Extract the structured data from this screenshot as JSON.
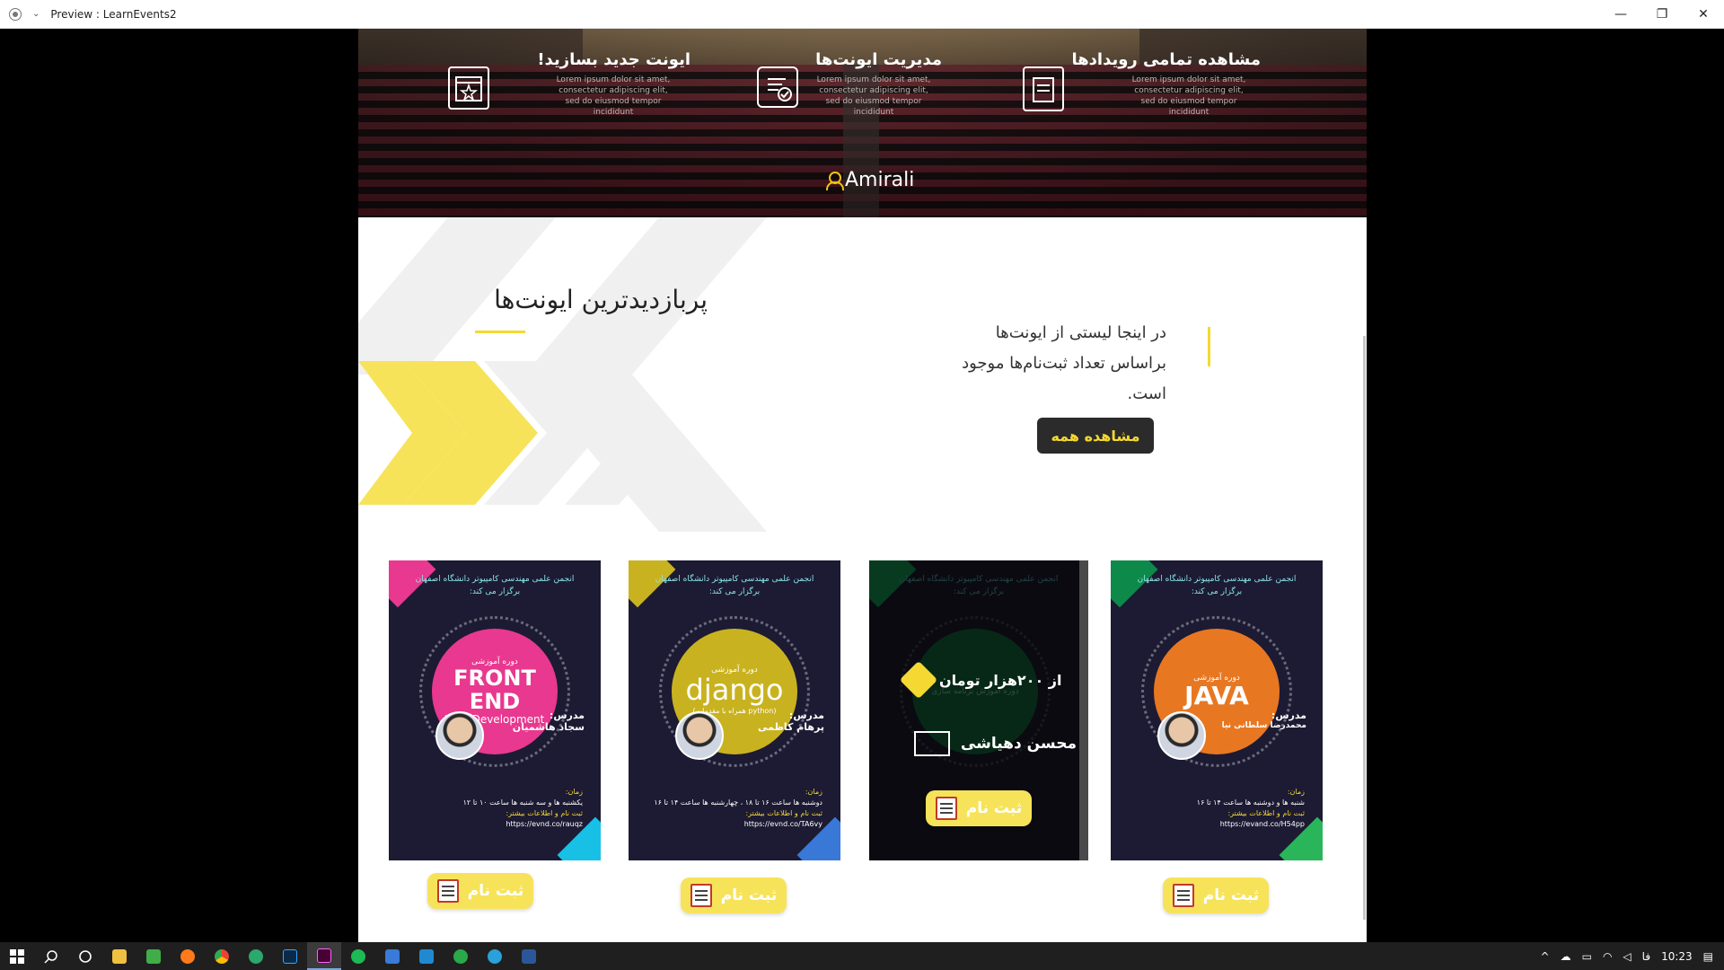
{
  "window": {
    "title": "Preview : LearnEvents2",
    "controls": {
      "minimize": "—",
      "restore": "❐",
      "close": "✕"
    }
  },
  "hero": {
    "features": [
      {
        "title": "مشاهده تمامی رویدادها",
        "desc": "Lorem ipsum dolor sit amet, consectetur adipiscing elit, sed do eiusmod tempor incididunt",
        "icon": "ticket-icon"
      },
      {
        "title": "مدیریت ایونت‌ها",
        "desc": "Lorem ipsum dolor sit amet, consectetur adipiscing elit, sed do eiusmod tempor incididunt",
        "icon": "checklist-icon"
      },
      {
        "title": "ایونت جدید بسازید!",
        "desc": "Lorem ipsum dolor sit amet, consectetur adipiscing elit, sed do eiusmod tempor incididunt",
        "icon": "calendar-icon"
      }
    ],
    "user": "Amirali"
  },
  "section": {
    "title": "پربازدیدترین ایونت‌ها",
    "desc": "در اینجا لیستی از ایونت‌ها براساس تعداد ثبت‌نام‌ها موجود است.",
    "button": "مشاهده همه"
  },
  "posters": [
    {
      "org": "انجمن علمی مهندسی کامپیوتر دانشگاه اصفهان\nبرگزار می کند:",
      "kind": "دوره آموزشی",
      "name": "FRONT END",
      "sub": "Web Development",
      "teacher_label": "مدرس:",
      "teacher": "سجاد هاشمیان",
      "time_label": "زمان:",
      "time": "یکشنبه ها و سه شنبه ها ساعت ۱۰ تا ۱۲",
      "more": "ثبت نام و اطلاعات بیشتر:",
      "link": "https://evnd.co/rauqz",
      "accent": "#e8388f",
      "register": "ثبت نام"
    },
    {
      "org": "انجمن علمی مهندسی کامپیوتر دانشگاه اصفهان\nبرگزار می کند:",
      "kind": "دوره آموزشی",
      "name": "django",
      "sub": "(همراه با مقدمات python)",
      "teacher_label": "مدرس:",
      "teacher": "پرهام کاظمی",
      "time_label": "زمان:",
      "time": "دوشنبه ها ساعت ۱۶ تا ۱۸ ، چهارشنبه ها ساعت ۱۴ تا ۱۶",
      "more": "ثبت نام و اطلاعات بیشتر:",
      "link": "https://evnd.co/TA6vy",
      "accent": "#c9b21f",
      "register": "ثبت نام"
    },
    {
      "org": "انجمن علمی مهندسی کامپیوتر دانشگاه اصفهان\nبرگزار می کند:",
      "kind": "دوره آموزش برنامه سازی",
      "price": "از ۲۰۰هزار تومان",
      "presenter": "محسن دهیاشی",
      "accent": "#0d6b3a",
      "register": "ثبت نام"
    },
    {
      "org": "انجمن علمی مهندسی کامپیوتر دانشگاه اصفهان\nبرگزار می کند:",
      "kind": "دوره آموزشی",
      "name": "JAVA",
      "teacher_label": "مدرس:",
      "teacher": "محمدرضا سلطانی نیا",
      "time_label": "زمان:",
      "time": "شنبه ها و دوشنبه ها ساعت ۱۴ تا ۱۶",
      "more": "ثبت نام و اطلاعات بیشتر:",
      "link": "https://evand.co/H54pp",
      "accent": "#e87722",
      "register": "ثبت نام"
    }
  ],
  "taskbar": {
    "lang": "فا",
    "time": "10:23"
  }
}
